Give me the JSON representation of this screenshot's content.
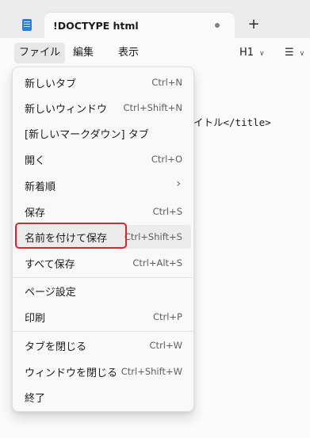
{
  "window": {
    "tab_title": "!DOCTYPE html",
    "new_tab_symbol": "+",
    "app_icon": "notepad-icon"
  },
  "menubar": {
    "file": "ファイル",
    "edit": "編集",
    "view": "表示",
    "heading": "H1",
    "heading_chevron": "∨",
    "list_symbol": "☰",
    "list_chevron": "∨"
  },
  "editor": {
    "visible_text": "イトル</title>"
  },
  "file_menu": {
    "items": [
      {
        "label": "新しいタブ",
        "shortcut": "Ctrl+N"
      },
      {
        "label": "新しいウィンドウ",
        "shortcut": "Ctrl+Shift+N"
      },
      {
        "label": "[新しいマークダウン] タブ",
        "shortcut": ""
      },
      {
        "label": "開く",
        "shortcut": "Ctrl+O"
      },
      {
        "label": "新着順",
        "shortcut": "",
        "submenu_arrow": "›"
      },
      {
        "label": "保存",
        "shortcut": "Ctrl+S"
      },
      {
        "label": "名前を付けて保存",
        "shortcut": "Ctrl+Shift+S",
        "highlighted": true
      },
      {
        "label": "すべて保存",
        "shortcut": "Ctrl+Alt+S"
      },
      {
        "label": "ページ設定",
        "shortcut": ""
      },
      {
        "label": "印刷",
        "shortcut": "Ctrl+P"
      },
      {
        "label": "タブを閉じる",
        "shortcut": "Ctrl+W"
      },
      {
        "label": "ウィンドウを閉じる",
        "shortcut": "Ctrl+Shift+W"
      },
      {
        "label": "終了",
        "shortcut": ""
      }
    ]
  },
  "colors": {
    "highlight_border": "#d7262d",
    "accent": "#2f7fd6"
  }
}
